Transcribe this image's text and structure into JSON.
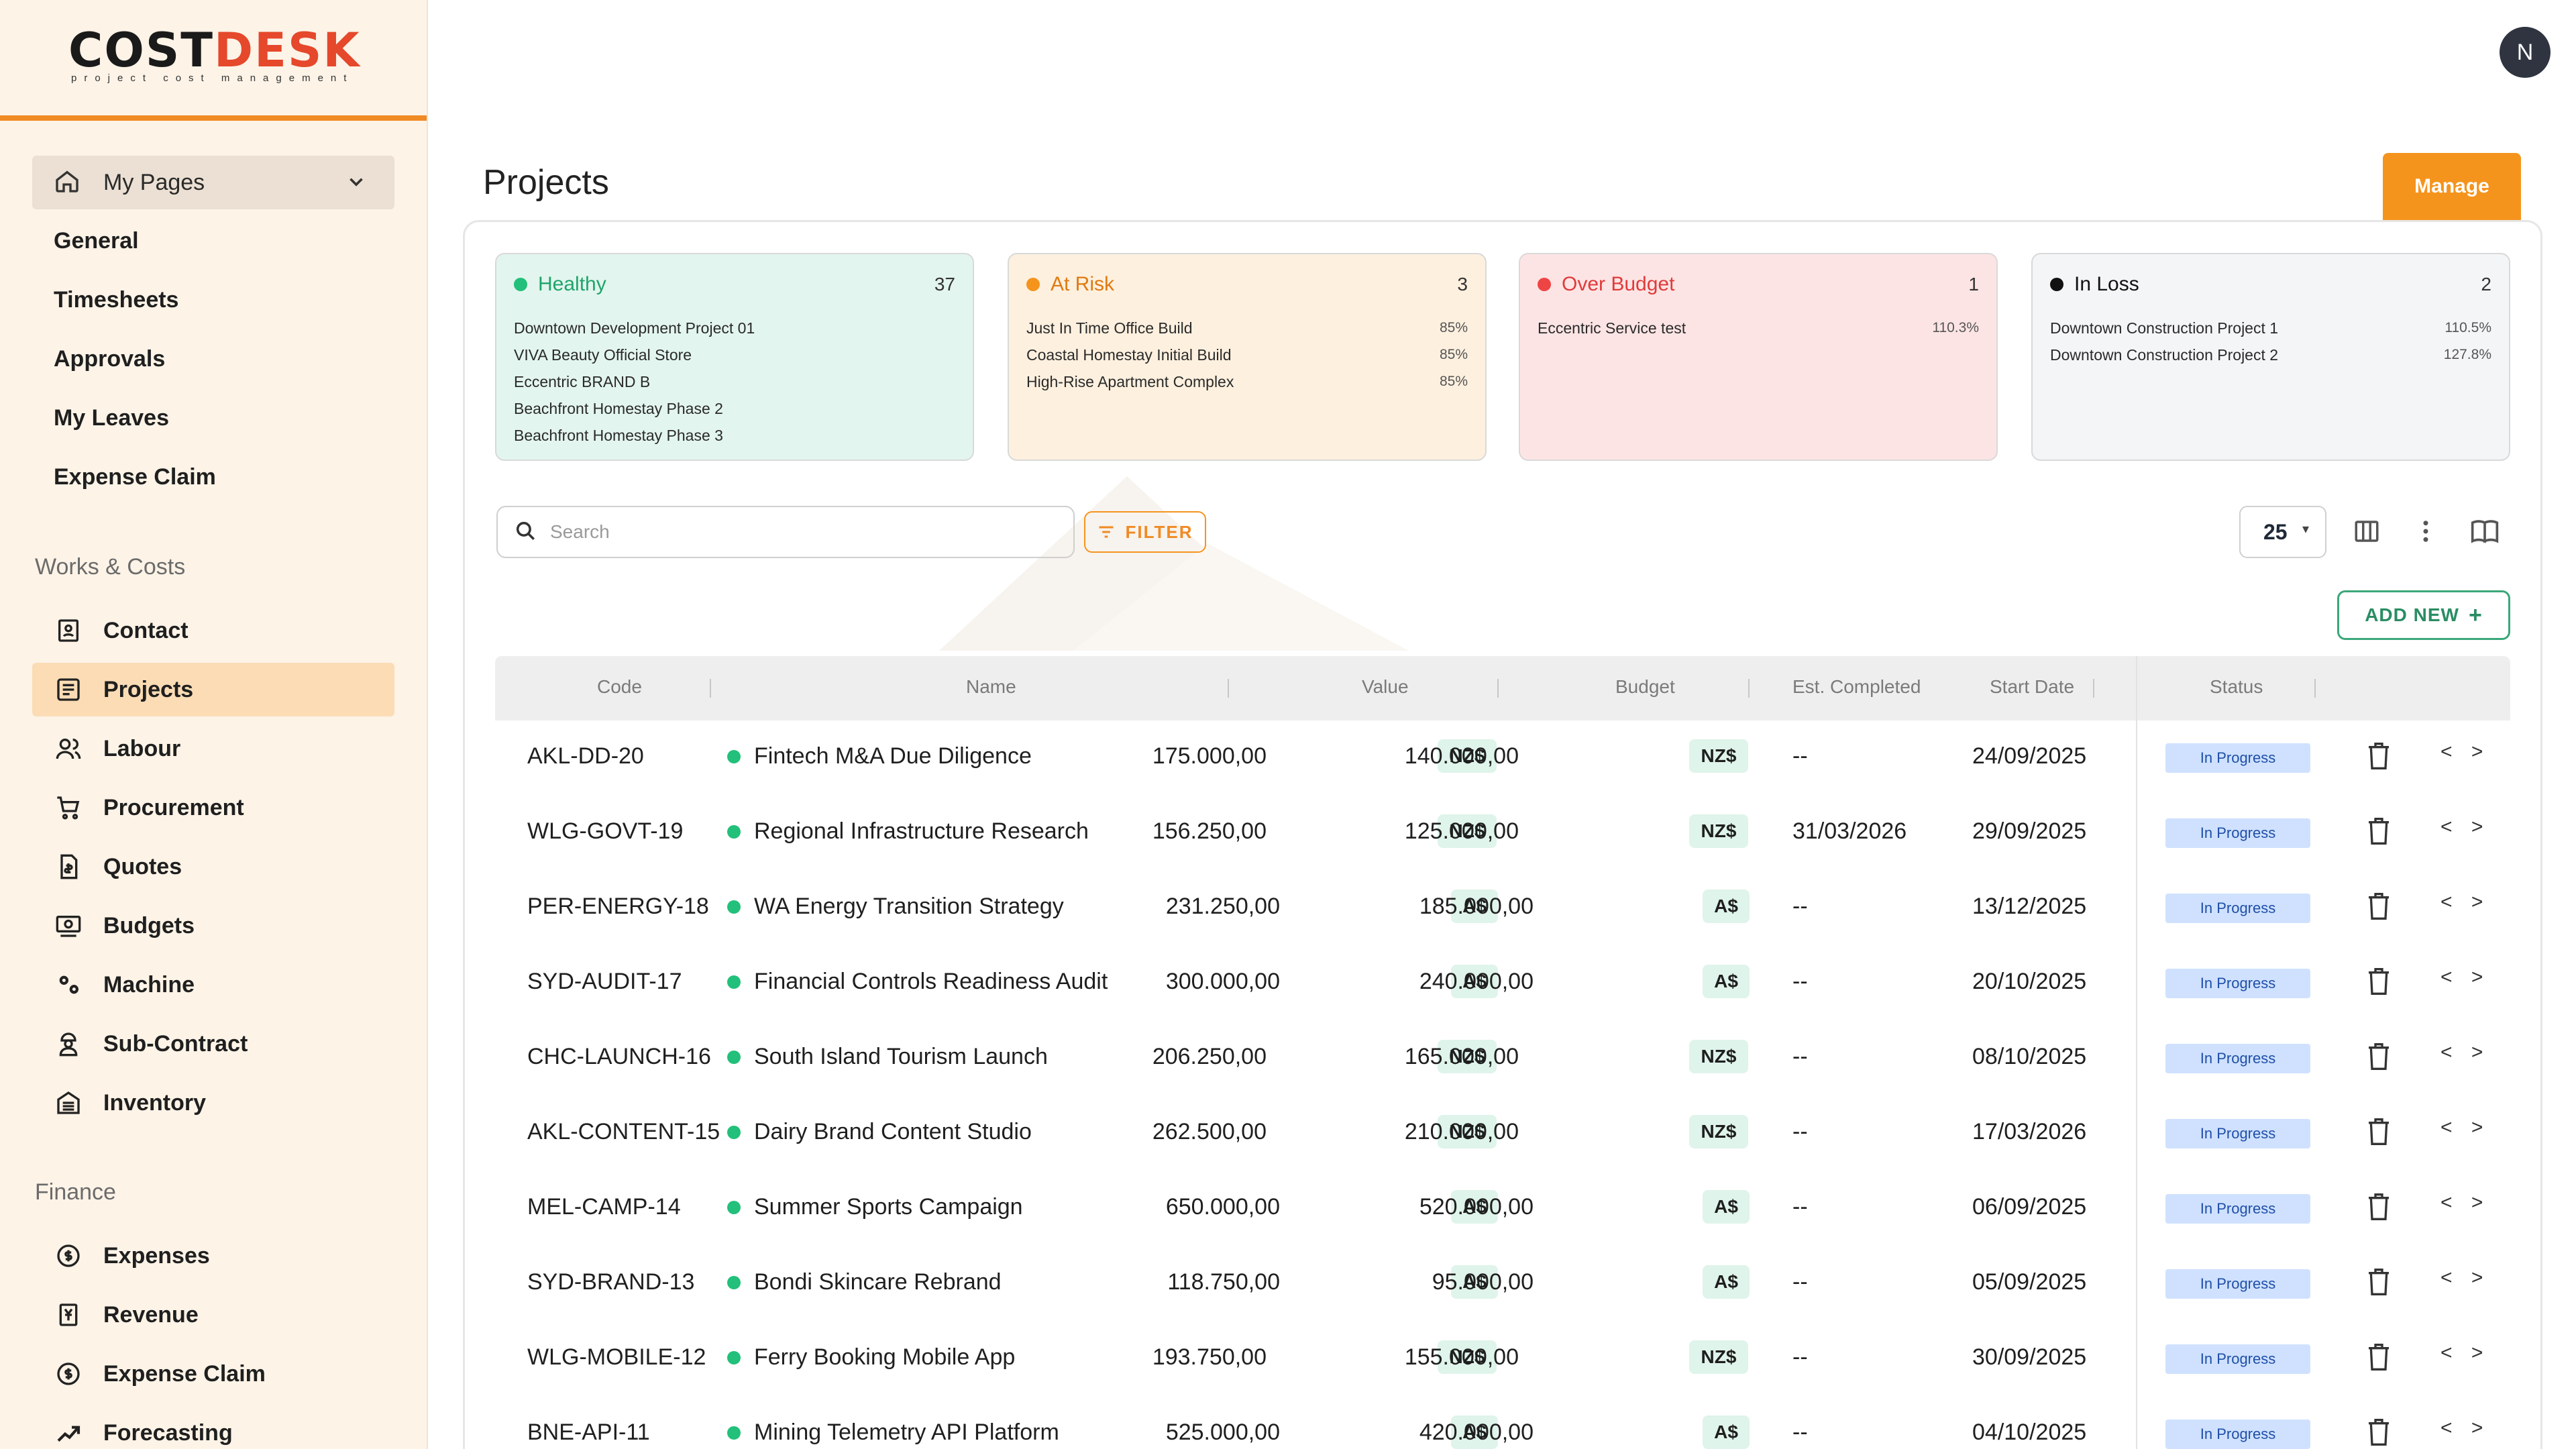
{
  "brand": {
    "logo_main": "COST",
    "logo_accent": "DESK",
    "logo_sub": "project cost management"
  },
  "user": {
    "initial": "N"
  },
  "sidebar": {
    "mypages_label": "My Pages",
    "sub_items": [
      "General",
      "Timesheets",
      "Approvals",
      "My Leaves",
      "Expense Claim"
    ],
    "works_label": "Works & Costs",
    "works_items": [
      {
        "label": "Contact",
        "icon": "contact-icon"
      },
      {
        "label": "Projects",
        "icon": "projects-icon"
      },
      {
        "label": "Labour",
        "icon": "labour-icon"
      },
      {
        "label": "Procurement",
        "icon": "cart-icon"
      },
      {
        "label": "Quotes",
        "icon": "quote-icon"
      },
      {
        "label": "Budgets",
        "icon": "budget-icon"
      },
      {
        "label": "Machine",
        "icon": "gears-icon"
      },
      {
        "label": "Sub-Contract",
        "icon": "worker-icon"
      },
      {
        "label": "Inventory",
        "icon": "inventory-icon"
      }
    ],
    "finance_label": "Finance",
    "finance_items": [
      {
        "label": "Expenses",
        "icon": "dollar-icon"
      },
      {
        "label": "Revenue",
        "icon": "revenue-icon"
      },
      {
        "label": "Expense Claim",
        "icon": "dollar-icon"
      },
      {
        "label": "Forecasting",
        "icon": "trend-icon"
      }
    ]
  },
  "page": {
    "title": "Projects",
    "manage_label": "Manage"
  },
  "cards": {
    "healthy": {
      "label": "Healthy",
      "count": "37",
      "color": "#22c07a",
      "rows": [
        "Downtown Development Project 01",
        "VIVA Beauty Official Store",
        "Eccentric BRAND B",
        "Beachfront Homestay Phase 2",
        "Beachfront Homestay Phase 3"
      ]
    },
    "atrisk": {
      "label": "At Risk",
      "count": "3",
      "color": "#f5941d",
      "rows": [
        {
          "name": "Just In Time Office Build",
          "pct": "85%"
        },
        {
          "name": "Coastal Homestay Initial Build",
          "pct": "85%"
        },
        {
          "name": "High-Rise Apartment Complex",
          "pct": "85%"
        }
      ]
    },
    "over": {
      "label": "Over Budget",
      "count": "1",
      "color": "#ef4444",
      "rows": [
        {
          "name": "Eccentric Service test",
          "pct": "110.3%"
        }
      ]
    },
    "loss": {
      "label": "In Loss",
      "count": "2",
      "color": "#111111",
      "rows": [
        {
          "name": "Downtown Construction Project 1",
          "pct": "110.5%"
        },
        {
          "name": "Downtown Construction Project 2",
          "pct": "127.8%"
        }
      ]
    }
  },
  "toolbar": {
    "search_placeholder": "Search",
    "filter_label": "FILTER",
    "page_size": "25",
    "add_new_label": "ADD NEW"
  },
  "table": {
    "headers": {
      "code": "Code",
      "name": "Name",
      "value": "Value",
      "budget": "Budget",
      "est": "Est. Completed",
      "start": "Start Date",
      "status": "Status"
    },
    "rows": [
      {
        "code": "AKL-DD-20",
        "name": "Fintech M&A Due Diligence",
        "value": "175.000,00",
        "vcur": "NZ$",
        "budget": "140.000,00",
        "bcur": "NZ$",
        "est": "--",
        "start": "24/09/2025",
        "status": "In Progress"
      },
      {
        "code": "WLG-GOVT-19",
        "name": "Regional Infrastructure Research",
        "value": "156.250,00",
        "vcur": "NZ$",
        "budget": "125.000,00",
        "bcur": "NZ$",
        "est": "31/03/2026",
        "start": "29/09/2025",
        "status": "In Progress"
      },
      {
        "code": "PER-ENERGY-18",
        "name": "WA Energy Transition Strategy",
        "value": "231.250,00",
        "vcur": "A$",
        "budget": "185.000,00",
        "bcur": "A$",
        "est": "--",
        "start": "13/12/2025",
        "status": "In Progress"
      },
      {
        "code": "SYD-AUDIT-17",
        "name": "Financial Controls Readiness Audit",
        "value": "300.000,00",
        "vcur": "A$",
        "budget": "240.000,00",
        "bcur": "A$",
        "est": "--",
        "start": "20/10/2025",
        "status": "In Progress"
      },
      {
        "code": "CHC-LAUNCH-16",
        "name": "South Island Tourism Launch",
        "value": "206.250,00",
        "vcur": "NZ$",
        "budget": "165.000,00",
        "bcur": "NZ$",
        "est": "--",
        "start": "08/10/2025",
        "status": "In Progress"
      },
      {
        "code": "AKL-CONTENT-15",
        "name": "Dairy Brand Content Studio",
        "value": "262.500,00",
        "vcur": "NZ$",
        "budget": "210.000,00",
        "bcur": "NZ$",
        "est": "--",
        "start": "17/03/2026",
        "status": "In Progress"
      },
      {
        "code": "MEL-CAMP-14",
        "name": "Summer Sports Campaign",
        "value": "650.000,00",
        "vcur": "A$",
        "budget": "520.000,00",
        "bcur": "A$",
        "est": "--",
        "start": "06/09/2025",
        "status": "In Progress"
      },
      {
        "code": "SYD-BRAND-13",
        "name": "Bondi Skincare Rebrand",
        "value": "118.750,00",
        "vcur": "A$",
        "budget": "95.000,00",
        "bcur": "A$",
        "est": "--",
        "start": "05/09/2025",
        "status": "In Progress"
      },
      {
        "code": "WLG-MOBILE-12",
        "name": "Ferry Booking Mobile App",
        "value": "193.750,00",
        "vcur": "NZ$",
        "budget": "155.000,00",
        "bcur": "NZ$",
        "est": "--",
        "start": "30/09/2025",
        "status": "In Progress"
      },
      {
        "code": "BNE-API-11",
        "name": "Mining Telemetry API Platform",
        "value": "525.000,00",
        "vcur": "A$",
        "budget": "420.000,00",
        "bcur": "A$",
        "est": "--",
        "start": "04/10/2025",
        "status": "In Progress"
      }
    ]
  }
}
